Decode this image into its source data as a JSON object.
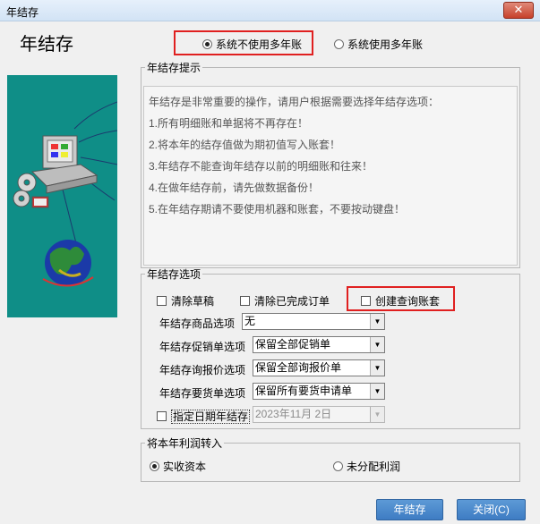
{
  "window": {
    "title": "年结存",
    "close_symbol": "✕"
  },
  "page_title": "年结存",
  "mode": {
    "options": [
      {
        "label": "系统不使用多年账",
        "selected": true
      },
      {
        "label": "系统使用多年账",
        "selected": false
      }
    ]
  },
  "tips": {
    "legend": "年结存提示",
    "lines": [
      "年结存是非常重要的操作，请用户根据需要选择年结存选项：",
      "1.所有明细账和单据将不再存在！",
      "2.将本年的结存值做为期初值写入账套！",
      "3.年结存不能查询年结存以前的明细账和往来！",
      "4.在做年结存前，请先做数据备份！",
      "5.在年结存期请不要使用机器和账套，不要按动键盘！"
    ]
  },
  "options": {
    "legend": "年结存选项",
    "checkboxes": [
      {
        "label": "清除草稿",
        "checked": false
      },
      {
        "label": "清除已完成订单",
        "checked": false
      },
      {
        "label": "创建查询账套",
        "checked": false
      }
    ],
    "selects": [
      {
        "label": "年结存商品选项",
        "value": "无"
      },
      {
        "label": "年结存促销单选项",
        "value": "保留全部促销单"
      },
      {
        "label": "年结存询报价选项",
        "value": "保留全部询报价单"
      },
      {
        "label": "年结存要货单选项",
        "value": "保留所有要货申请单"
      }
    ],
    "date_option": {
      "label": "指定日期年结存",
      "checked": false,
      "value": "2023年11月 2日",
      "disabled": true
    }
  },
  "profit": {
    "legend": "将本年利润转入",
    "options": [
      {
        "label": "实收资本",
        "selected": true
      },
      {
        "label": "未分配利润",
        "selected": false
      }
    ]
  },
  "buttons": {
    "confirm": "年结存",
    "close": "关闭(C)"
  },
  "colors": {
    "highlight_box": "#e02020",
    "art_background": "#0f8e87",
    "button_blue": "#4a88cc"
  }
}
